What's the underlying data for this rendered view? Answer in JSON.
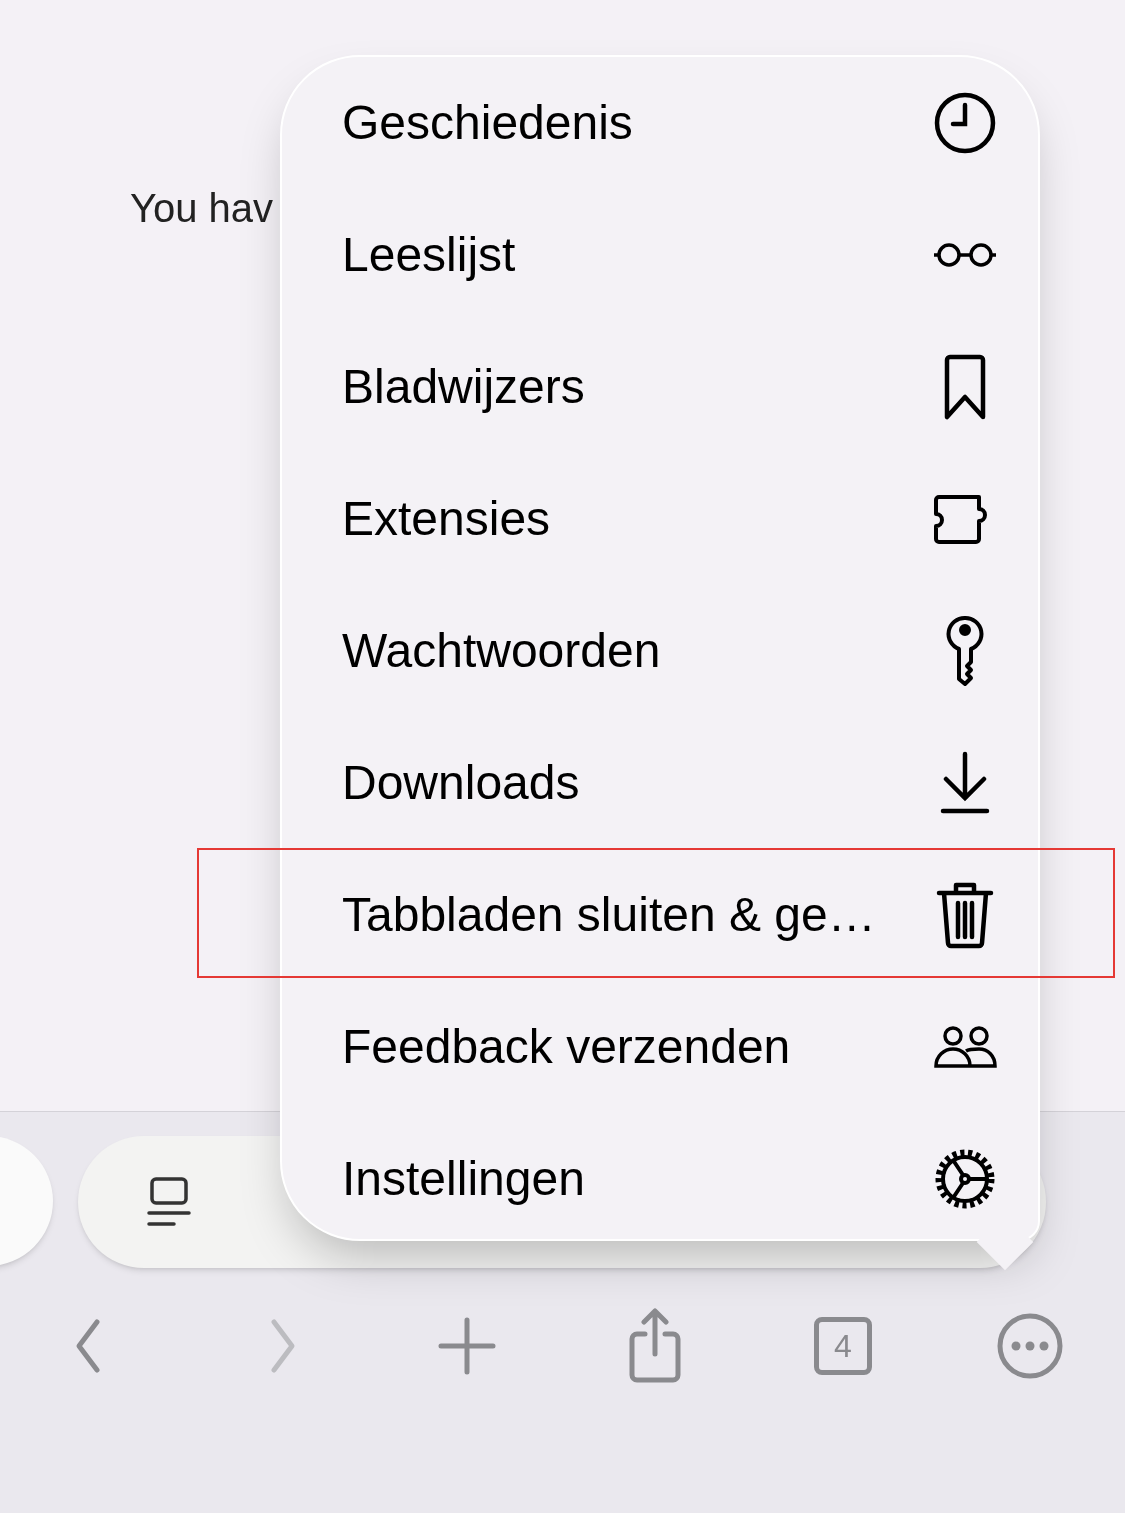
{
  "page": {
    "text": "You hav"
  },
  "menu": {
    "items": [
      {
        "label": "Geschiedenis",
        "kind": "clock",
        "highlighted": false
      },
      {
        "label": "Leeslijst",
        "kind": "glasses",
        "highlighted": false
      },
      {
        "label": "Bladwijzers",
        "kind": "bookmark",
        "highlighted": false
      },
      {
        "label": "Extensies",
        "kind": "puzzle",
        "highlighted": false
      },
      {
        "label": "Wachtwoorden",
        "kind": "key",
        "highlighted": false
      },
      {
        "label": "Downloads",
        "kind": "download",
        "highlighted": false
      },
      {
        "label": "Tabbladen sluiten & ge…",
        "kind": "trash",
        "highlighted": true
      },
      {
        "label": "Feedback verzenden",
        "kind": "people",
        "highlighted": false
      },
      {
        "label": "Instellingen",
        "kind": "gear",
        "highlighted": false
      }
    ]
  },
  "toolbar": {
    "buttons": [
      {
        "kind": "back",
        "disabled": false
      },
      {
        "kind": "forward",
        "disabled": true
      },
      {
        "kind": "new-tab",
        "disabled": false
      },
      {
        "kind": "share",
        "disabled": false
      },
      {
        "kind": "tabs",
        "count": "4",
        "disabled": false
      },
      {
        "kind": "more",
        "disabled": false
      }
    ]
  }
}
